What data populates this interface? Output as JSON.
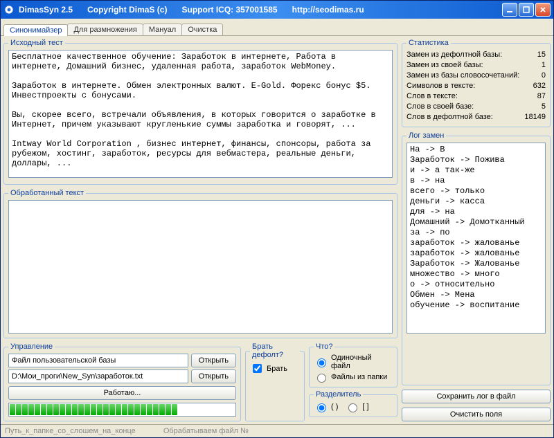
{
  "titlebar": {
    "app": "DimasSyn 2.5",
    "copyright": "Copyright DimaS (c)",
    "support": "Support ICQ: 357001585",
    "url": "http://seodimas.ru"
  },
  "tabs": [
    "Синонимайзер",
    "Для размножения",
    "Мануал",
    "Очистка"
  ],
  "groups": {
    "source": "Исходный тест",
    "output": "Обработанный текст",
    "management": "Управление",
    "take_default": "Брать дефолт?",
    "what": "Что?",
    "separator": "Разделитель",
    "stats": "Статистика",
    "log": "Лог замен"
  },
  "source_text": "Бесплатное качественное обучение: Заработок в интернете, Работа в интернете, Домашний бизнес, удаленная работа, заработок WebMoney.\n\nЗаработок в интернете. Обмен электронных валют. E-Gold. Форекс бонус $5. Инвестпроекты с бонусами.\n\nВы, скорее всего, встречали объявления, в которых говорится о заработке в Интернет, причем указывают кругленькие суммы заработка и говорят, ...\n\nIntway World Corporation , бизнес интернет, финансы, спонсоры, работа за рубежом, хостинг, заработок, ресурсы для вебмастера, реальные деньги, доллары, ...",
  "output_text": "",
  "management": {
    "user_base_label": "Файл пользовательской базы",
    "user_base_path": "D:\\Мои_проги\\New_Syn\\заработок.txt",
    "open": "Открыть",
    "work": "Работаю..."
  },
  "take_default": {
    "label": "Брать"
  },
  "what": {
    "single": "Одиночный файл",
    "folder": "Файлы из папки"
  },
  "separator": {
    "opt1": "( )",
    "opt2": "[ ]"
  },
  "stats": {
    "items": [
      {
        "k": "Замен из дефолтной базы:",
        "v": "15"
      },
      {
        "k": "Замен из своей базы:",
        "v": "1"
      },
      {
        "k": "Замен из базы словосочетаний:",
        "v": "0"
      },
      {
        "k": "Символов в тексте:",
        "v": "632"
      },
      {
        "k": "Слов в тексте:",
        "v": "87"
      },
      {
        "k": "Слов в своей базе:",
        "v": "5"
      },
      {
        "k": "Слов в дефолтной базе:",
        "v": "18149"
      }
    ]
  },
  "log_lines": [
    "На -> В",
    "Заработок -> Пожива",
    "и -> а так-же",
    "в -> на",
    "всего -> только",
    "деньги -> касса",
    "для -> на",
    "Домашний -> Домотканный",
    "за -> по",
    "заработок -> жалованье",
    "заработок -> жалованье",
    "Заработок -> Жалованье",
    "множество -> много",
    "о -> относительно",
    "Обмен -> Мена",
    "обучение -> воспитание"
  ],
  "right_buttons": {
    "save": "Сохранить лог в файл",
    "clear": "Очистить поля"
  },
  "status": {
    "left": "Путь_к_папке_со_слошем_на_конце",
    "right": "Обрабатываем файл №"
  },
  "progress_fill": 27
}
